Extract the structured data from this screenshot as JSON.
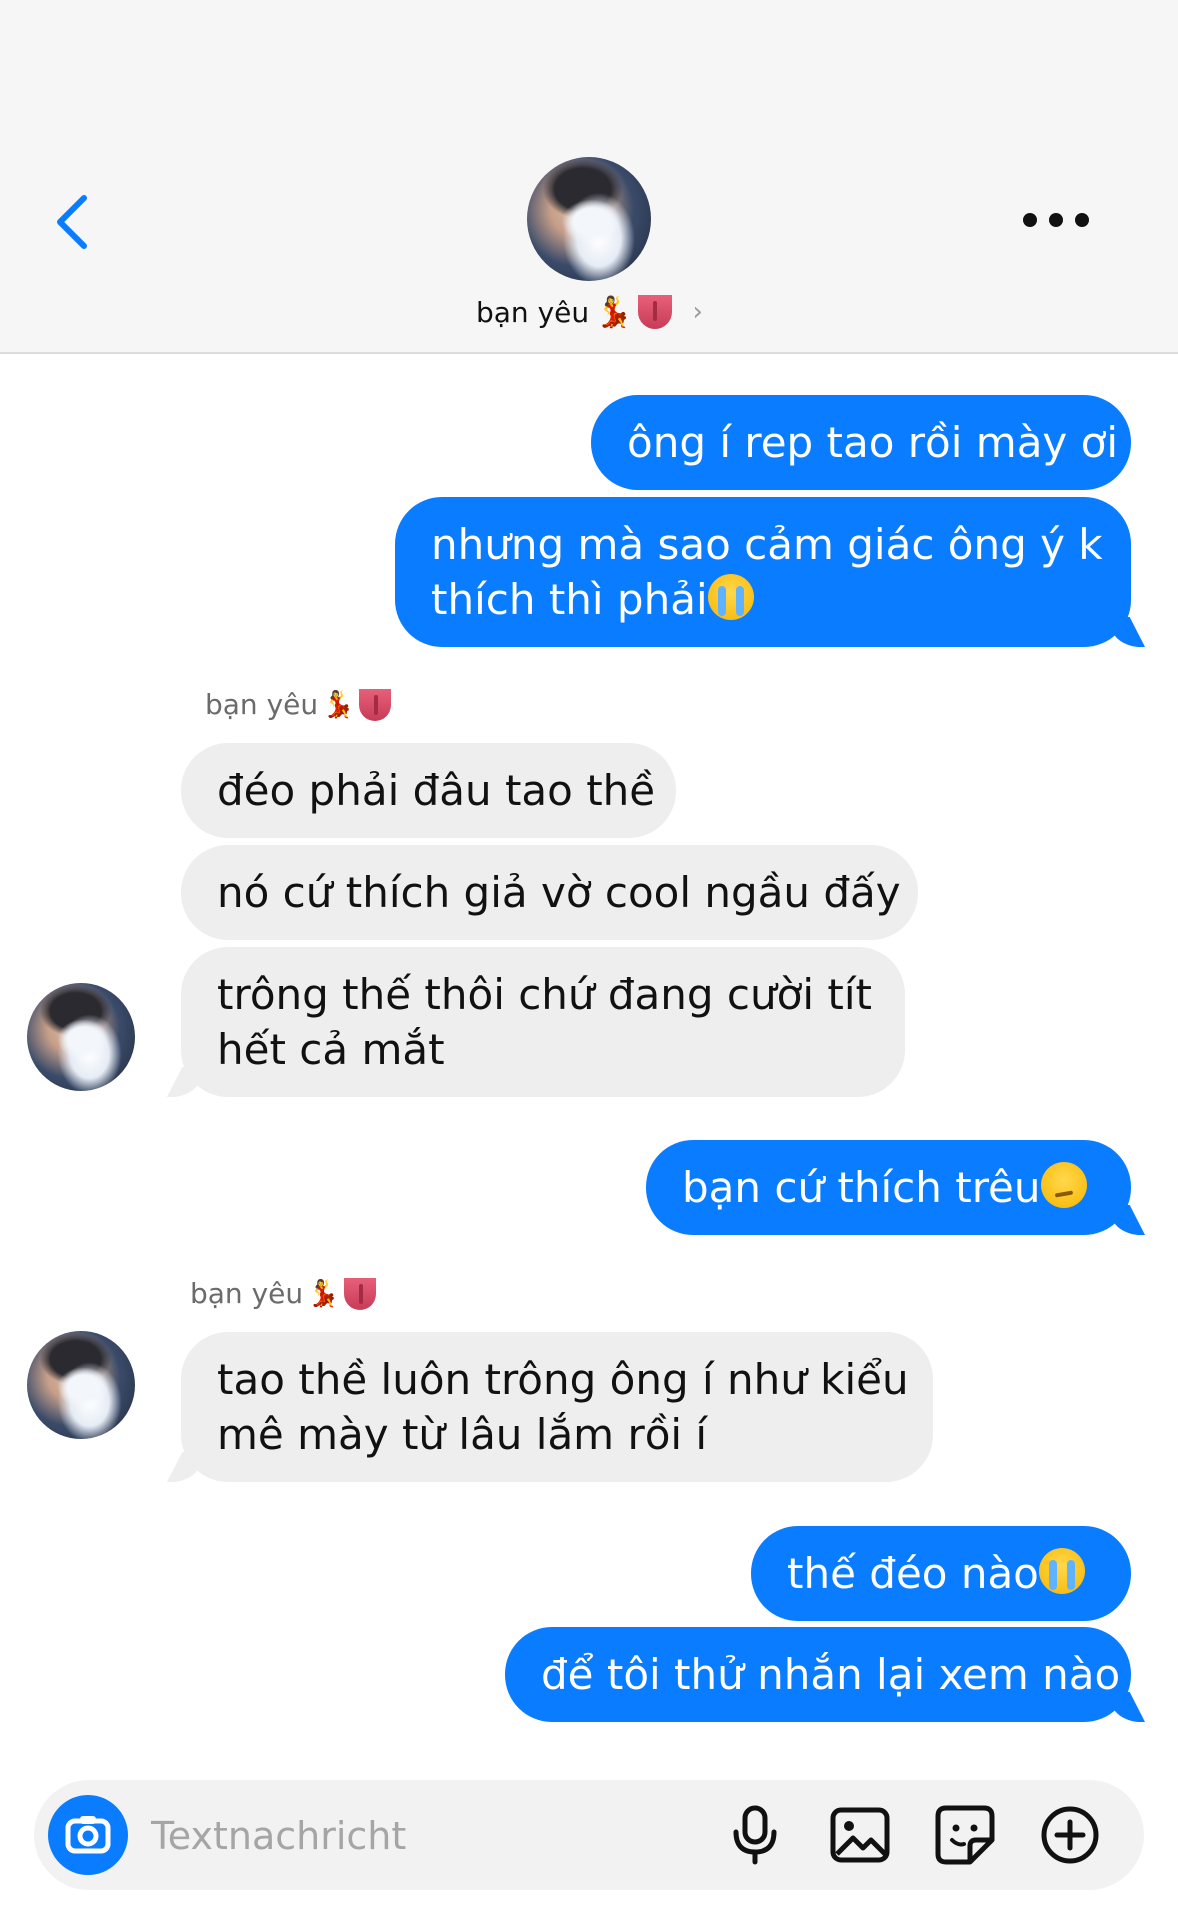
{
  "header": {
    "contact_name": "bạn yêu",
    "name_emoji_1": "💃",
    "icons": [
      "back-chevron-icon",
      "more-dots-icon",
      "chevron-right-icon"
    ]
  },
  "messages": [
    {
      "dir": "out",
      "text": "ông í rep tao rồi mày ơi"
    },
    {
      "dir": "out",
      "line1": "nhưng mà sao cảm giác ông ý k",
      "line2": "thích thì phải",
      "emoji": "crying-face"
    },
    {
      "dir": "in",
      "sender": "bạn yêu",
      "text": "đéo phải đâu tao thề"
    },
    {
      "dir": "in",
      "text": "nó cứ thích giả vờ cool ngầu đấy"
    },
    {
      "dir": "in",
      "line1": "trông thế thôi chứ đang cười tít",
      "line2": "hết cả mắt"
    },
    {
      "dir": "out",
      "text": "bạn cứ thích trêu",
      "emoji": "lying-face"
    },
    {
      "dir": "in",
      "sender": "bạn yêu",
      "line1": "tao thề luôn trông ông í như kiểu",
      "line2": "mê mày từ lâu lắm rồi í"
    },
    {
      "dir": "out",
      "text": "thế đéo nào",
      "emoji": "crying-face"
    },
    {
      "dir": "out",
      "text": "để tôi thử nhắn lại xem nào"
    }
  ],
  "composer": {
    "placeholder": "Textnachricht",
    "icons": [
      "camera-icon",
      "microphone-icon",
      "image-icon",
      "sticker-icon",
      "plus-circle-icon"
    ]
  },
  "colors": {
    "outgoing_bubble": "#0a7cff",
    "incoming_bubble": "#eeeeef",
    "header_bg": "#f6f6f6"
  }
}
